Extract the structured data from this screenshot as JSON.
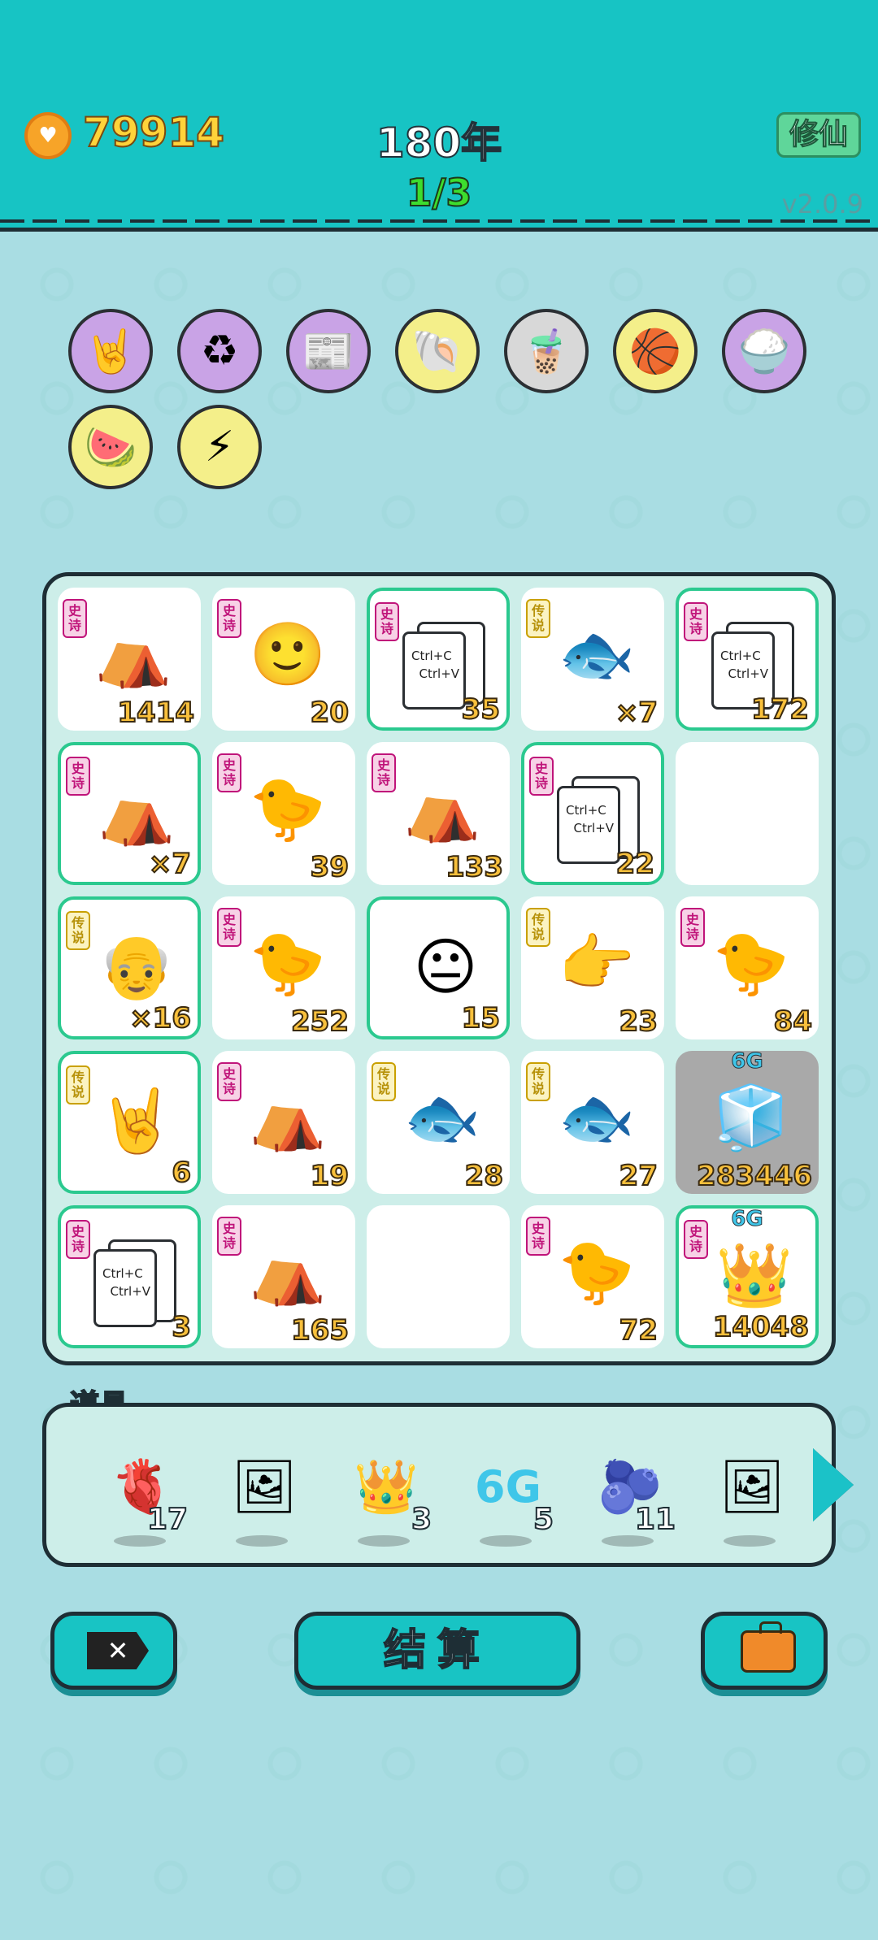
{
  "header": {
    "coins": "79914",
    "years": "180年",
    "round": "1/3",
    "mode_button": "修仙",
    "version": "v2.0.9"
  },
  "relics": [
    {
      "icon": "rock-hand-icon",
      "glyph": "🤘",
      "bg": "#c9a3e6"
    },
    {
      "icon": "recycle-icon",
      "glyph": "♻",
      "bg": "#c9a3e6"
    },
    {
      "icon": "time-magazine-icon",
      "glyph": "📰",
      "bg": "#c9a3e6"
    },
    {
      "icon": "shell-icon",
      "glyph": "🐚",
      "bg": "#f4ef8a"
    },
    {
      "icon": "bubble-tea-icon",
      "glyph": "🧋",
      "bg": "#d8d8d8"
    },
    {
      "icon": "basketballs-icon",
      "glyph": "🏀",
      "bg": "#f4ef8a"
    },
    {
      "icon": "rice-bowl-icon",
      "glyph": "🍚",
      "bg": "#c9a3e6"
    },
    {
      "icon": "fruit-platter-icon",
      "glyph": "🍉",
      "bg": "#f4ef8a"
    },
    {
      "icon": "lightning-icon",
      "glyph": "⚡",
      "bg": "#f4ef8a"
    }
  ],
  "tags": {
    "epic": "史诗",
    "legend": "传说"
  },
  "board": [
    {
      "tag": "epic",
      "icon": "lantern-tent-icon",
      "glyph": "⛺",
      "value": "1414",
      "hl": false
    },
    {
      "tag": "epic",
      "icon": "yellow-face-icon",
      "glyph": "🙂",
      "value": "20",
      "hl": false
    },
    {
      "tag": "epic",
      "icon": "ctrl-c-v-icon",
      "ctrl": true,
      "value": "35",
      "hl": true
    },
    {
      "tag": "legend",
      "icon": "koi-fish-icon",
      "glyph": "🐟",
      "value": "×7",
      "hl": false
    },
    {
      "tag": "epic",
      "icon": "ctrl-c-v-icon",
      "ctrl": true,
      "value": "172",
      "hl": true
    },
    {
      "tag": "epic",
      "icon": "lantern-tent-icon",
      "glyph": "⛺",
      "value": "×7",
      "hl": true
    },
    {
      "tag": "epic",
      "icon": "chick-basketball-icon",
      "glyph": "🐤",
      "value": "39",
      "hl": false
    },
    {
      "tag": "epic",
      "icon": "crowned-tent-icon",
      "glyph": "⛺",
      "value": "133",
      "hl": false
    },
    {
      "tag": "epic",
      "icon": "ctrl-c-v-icon",
      "ctrl": true,
      "value": "22",
      "hl": true
    },
    {
      "empty": true
    },
    {
      "tag": "legend",
      "icon": "old-man-icon",
      "glyph": "👴",
      "value": "×16",
      "hl": true
    },
    {
      "tag": "epic",
      "icon": "gray-hair-chick-icon",
      "glyph": "🐤",
      "value": "252",
      "hl": false
    },
    {
      "icon": "man-face-icon",
      "glyph": "😐",
      "value": "15",
      "hl": true
    },
    {
      "tag": "legend",
      "icon": "pointing-hand-icon",
      "glyph": "👉",
      "value": "23",
      "hl": false
    },
    {
      "tag": "epic",
      "icon": "gray-hair-chick-icon",
      "glyph": "🐤",
      "value": "84",
      "hl": false
    },
    {
      "tag": "legend",
      "icon": "rock-hand-icon",
      "glyph": "🤘",
      "value": "6",
      "hl": true
    },
    {
      "tag": "epic",
      "icon": "lantern-tent-icon",
      "glyph": "⛺",
      "value": "19",
      "hl": false
    },
    {
      "tag": "legend",
      "icon": "koi-fish-icon",
      "glyph": "🐟",
      "value": "28",
      "hl": false
    },
    {
      "tag": "legend",
      "icon": "koi-fish-icon",
      "glyph": "🐟",
      "value": "27",
      "hl": false
    },
    {
      "icon": "fridge-icon",
      "glyph": "🧊",
      "value": "283446",
      "sixg": "6G",
      "gray": true,
      "hl": false
    },
    {
      "tag": "epic",
      "icon": "ctrl-c-v-icon",
      "ctrl": true,
      "value": "3",
      "hl": true
    },
    {
      "tag": "epic",
      "icon": "lantern-tent-icon",
      "glyph": "⛺",
      "value": "165",
      "hl": false
    },
    {
      "empty": true
    },
    {
      "tag": "epic",
      "icon": "red-cap-chick-icon",
      "glyph": "🐤",
      "value": "72",
      "hl": false
    },
    {
      "tag": "epic",
      "icon": "crowned-bearded-man-icon",
      "glyph": "👑",
      "value": "14048",
      "sixg": "6G",
      "hl": true
    }
  ],
  "ctrl_text": {
    "line1": "Ctrl+C",
    "line2": "Ctrl+V"
  },
  "items": {
    "label": "道具",
    "list": [
      {
        "icon": "liver-icon",
        "glyph": "🫀",
        "count": "17"
      },
      {
        "icon": "frame-icon",
        "glyph": "🖼",
        "count": ""
      },
      {
        "icon": "crown-icon",
        "glyph": "👑",
        "count": "3"
      },
      {
        "icon": "6g-icon",
        "glyph": "6G",
        "count": "5"
      },
      {
        "icon": "blueberry-icon",
        "glyph": "🫐",
        "count": "11"
      },
      {
        "icon": "frame-icon",
        "glyph": "🖼",
        "count": ""
      }
    ]
  },
  "buttons": {
    "close": "✕",
    "settle": "结算"
  }
}
